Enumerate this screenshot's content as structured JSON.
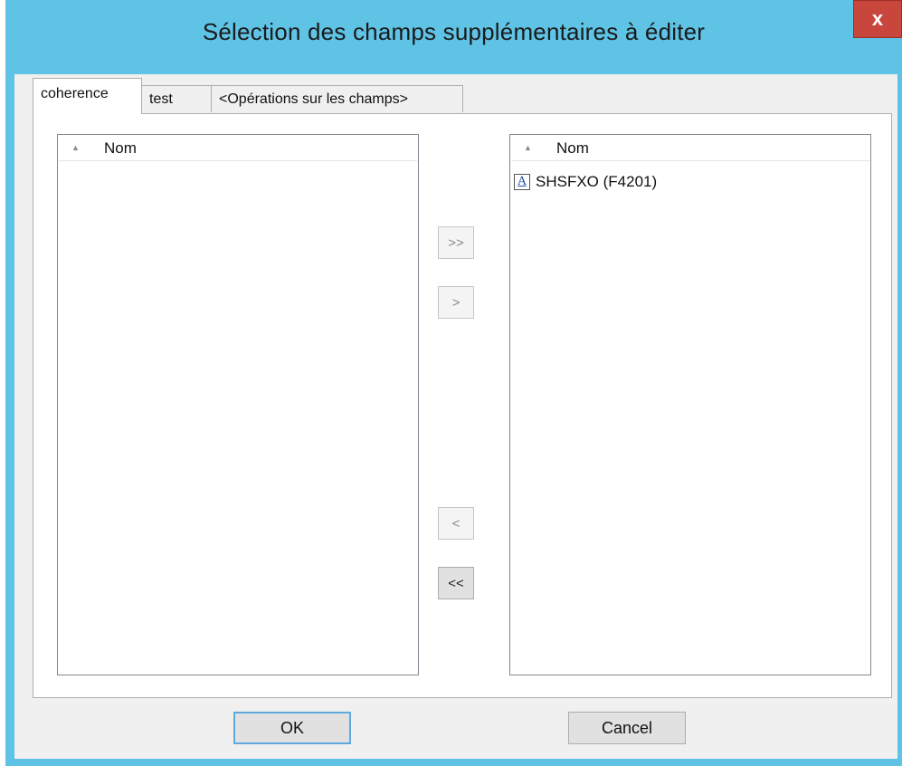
{
  "window": {
    "title": "Sélection des champs supplémentaires à éditer",
    "close_label": "x"
  },
  "tabs": [
    {
      "label": "coherence",
      "active": true
    },
    {
      "label": "test",
      "active": false
    },
    {
      "label": "<Opérations sur les champs>",
      "active": false
    }
  ],
  "left_list": {
    "header": "Nom",
    "items": []
  },
  "right_list": {
    "header": "Nom",
    "items": [
      {
        "label": "SHSFXO (F4201)",
        "icon": "text-field-icon",
        "icon_glyph": "A"
      }
    ]
  },
  "move_buttons": {
    "add_all": ">>",
    "add": ">",
    "remove": "<",
    "remove_all": "<<"
  },
  "footer": {
    "ok_label": "OK",
    "cancel_label": "Cancel"
  },
  "colors": {
    "title_bar": "#5fc3e6",
    "close_button": "#c9463d",
    "client_background": "#f0f0f0"
  }
}
